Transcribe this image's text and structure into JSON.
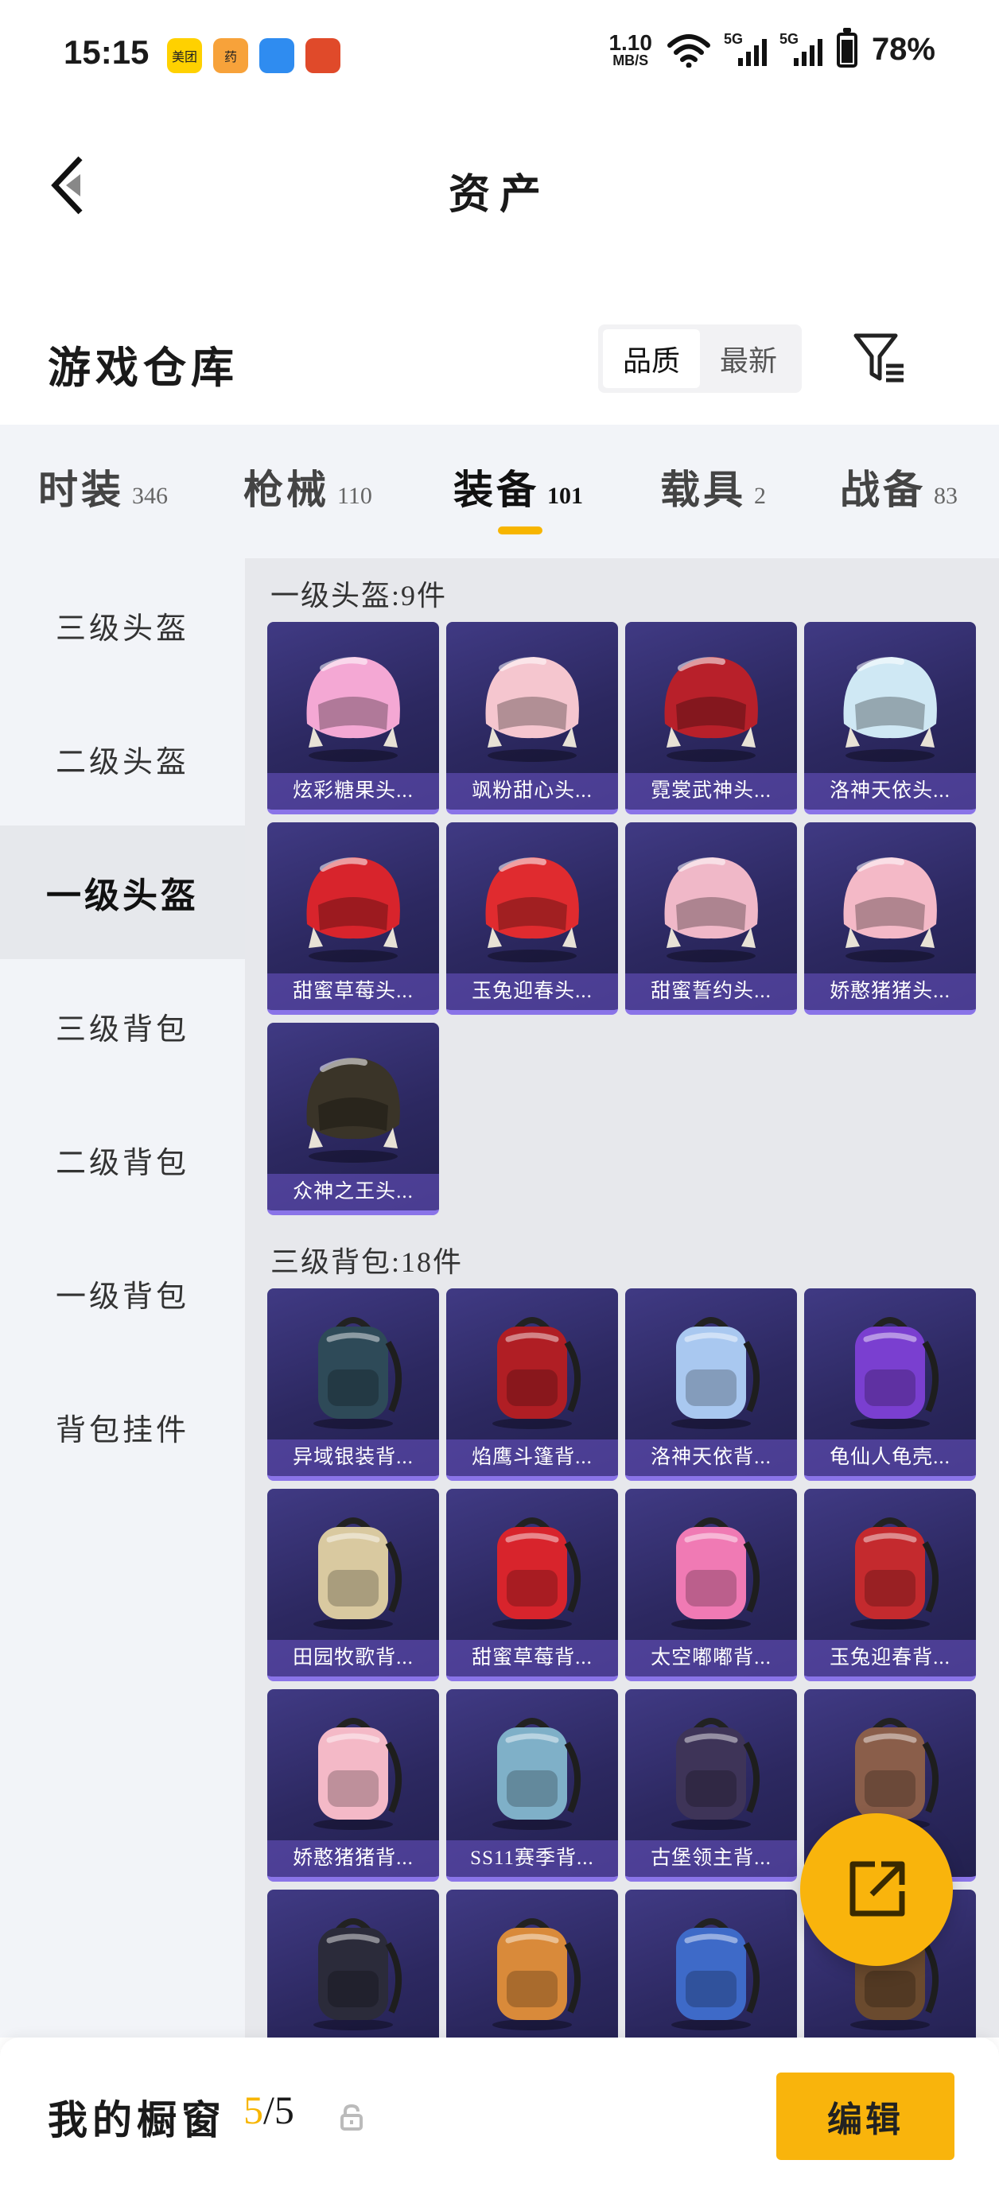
{
  "status_bar": {
    "time": "15:15",
    "apps": [
      {
        "icon": "meituan-app-icon",
        "text": "美团",
        "color": "#ffd100"
      },
      {
        "icon": "yaodian-app-icon",
        "text": "药",
        "color": "#f7a23a"
      },
      {
        "icon": "browser-app-icon",
        "text": "",
        "color": "#2f8cf0"
      },
      {
        "icon": "game-app-icon",
        "text": "",
        "color": "#e04a2a"
      }
    ],
    "net_speed_value": "1.10",
    "net_speed_unit": "MB/S",
    "signal_1": "5G",
    "signal_2": "5G",
    "battery": "78%",
    "battery_level": 0.78
  },
  "header": {
    "title": "资产"
  },
  "warehouse": {
    "title": "游戏仓库",
    "sort_options": [
      "品质",
      "最新"
    ],
    "sort_selected": 0
  },
  "tabs": [
    {
      "name": "时装",
      "count": "346"
    },
    {
      "name": "枪械",
      "count": "110"
    },
    {
      "name": "装备",
      "count": "101"
    },
    {
      "name": "载具",
      "count": "2"
    },
    {
      "name": "战备",
      "count": "83"
    }
  ],
  "active_tab": 2,
  "sidebar": {
    "items": [
      "三级头盔",
      "二级头盔",
      "一级头盔",
      "三级背包",
      "二级背包",
      "一级背包",
      "背包挂件"
    ],
    "active": 2
  },
  "sections": [
    {
      "title": "一级头盔:9件",
      "items": [
        {
          "label": "炫彩糖果头...",
          "color": "#f4a8d4"
        },
        {
          "label": "飒粉甜心头...",
          "color": "#f5c6cf"
        },
        {
          "label": "霓裳武神头...",
          "color": "#b8202a"
        },
        {
          "label": "洛神天依头...",
          "color": "#cfe8f4"
        },
        {
          "label": "甜蜜草莓头...",
          "color": "#d8242c"
        },
        {
          "label": "玉兔迎春头...",
          "color": "#e02b2f"
        },
        {
          "label": "甜蜜誓约头...",
          "color": "#f0b8c8"
        },
        {
          "label": "娇憨猪猪头...",
          "color": "#f4b9c7"
        },
        {
          "label": "众神之王头...",
          "color": "#3a3428"
        }
      ]
    },
    {
      "title": "三级背包:18件",
      "items": [
        {
          "label": "异域银装背...",
          "color": "#2e4a58"
        },
        {
          "label": "焰鹰斗篷背...",
          "color": "#b01e24"
        },
        {
          "label": "洛神天依背...",
          "color": "#a9c8f0"
        },
        {
          "label": "龟仙人龟壳...",
          "color": "#7a3fd0"
        },
        {
          "label": "田园牧歌背...",
          "color": "#d9c9a0"
        },
        {
          "label": "甜蜜草莓背...",
          "color": "#d8242c"
        },
        {
          "label": "太空嘟嘟背...",
          "color": "#f07ab4"
        },
        {
          "label": "玉兔迎春背...",
          "color": "#c42a2e"
        },
        {
          "label": "娇憨猪猪背...",
          "color": "#f4b9c7"
        },
        {
          "label": "SS11赛季背...",
          "color": "#7fb0c8"
        },
        {
          "label": "古堡领主背...",
          "color": "#3e3458"
        },
        {
          "label": "",
          "color": "#8a5e4a"
        },
        {
          "label": "",
          "color": "#2b2b3a"
        },
        {
          "label": "",
          "color": "#d98a3a"
        },
        {
          "label": "",
          "color": "#3e6ac8"
        },
        {
          "label": "",
          "color": "#6a4a2e"
        }
      ]
    }
  ],
  "bottom_bar": {
    "label": "我的橱窗",
    "count_current": "5",
    "count_total": "/5",
    "edit_label": "编辑"
  },
  "colors": {
    "accent": "#f9b40c",
    "card_bg": "#2c2860",
    "card_label_bg": "#6c56c8"
  }
}
